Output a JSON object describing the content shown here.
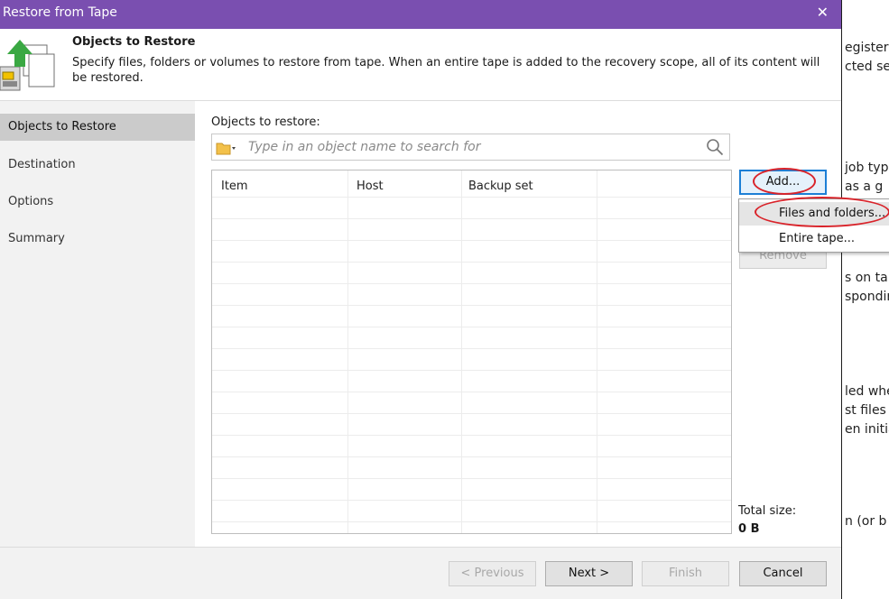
{
  "window": {
    "title": "Restore from Tape",
    "close_label": "✕"
  },
  "header": {
    "title": "Objects to Restore",
    "description": "Specify files, folders or volumes to restore from tape. When an entire tape is added to the recovery scope, all of its content will be restored."
  },
  "nav": {
    "items": [
      {
        "label": "Objects to Restore",
        "active": true
      },
      {
        "label": "Destination",
        "active": false
      },
      {
        "label": "Options",
        "active": false
      },
      {
        "label": "Summary",
        "active": false
      }
    ]
  },
  "main": {
    "objects_label": "Objects to restore:",
    "search_placeholder": "Type in an object name to search for",
    "columns": [
      "Item",
      "Host",
      "Backup set",
      ""
    ],
    "rows": [],
    "add_button": "Add...",
    "remove_button": "Remove",
    "total_size_label": "Total size:",
    "total_size_value": "0 B"
  },
  "add_menu": {
    "items": [
      "Files and folders...",
      "Entire tape..."
    ]
  },
  "footer": {
    "previous": "< Previous",
    "next": "Next >",
    "finish": "Finish",
    "cancel": "Cancel"
  },
  "background_doc": {
    "lines": [
      "egister",
      "cted ser",
      "job typ",
      "as a g",
      "s on tap",
      "spondir",
      "led whe",
      "st files",
      "en initia",
      "n (or b"
    ]
  },
  "colors": {
    "titlebar": "#7a4fb0",
    "annotation": "#d9232a",
    "focus_border": "#1c7fd6"
  }
}
